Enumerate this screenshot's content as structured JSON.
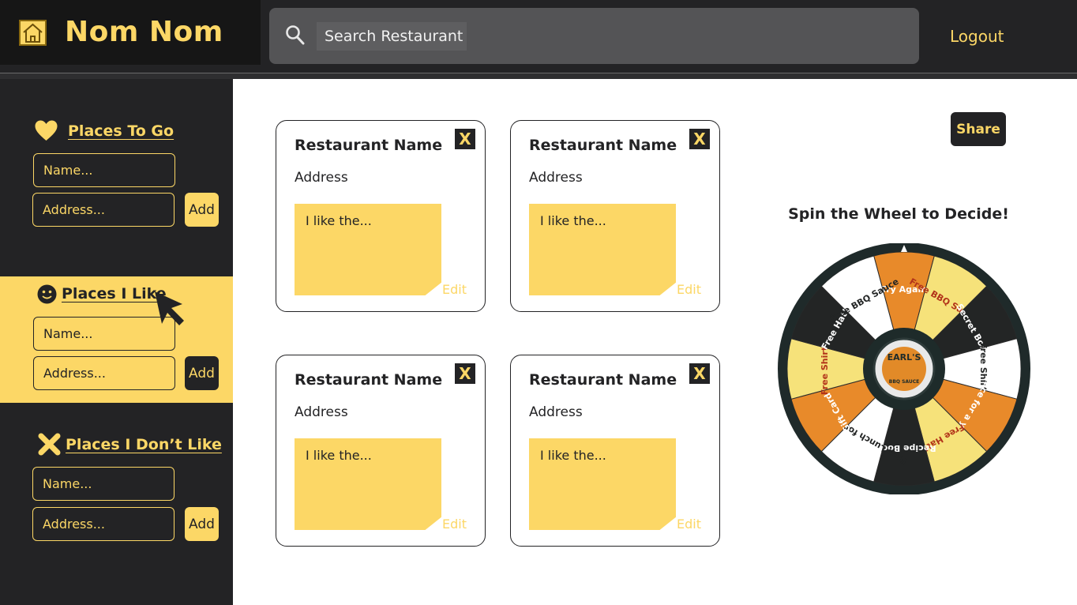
{
  "header": {
    "brand": "Nom Nom",
    "search_placeholder": "Search Restaurant",
    "logout": "Logout"
  },
  "sidebar": {
    "sections": [
      {
        "title": "Places To Go",
        "icon": "heart-icon",
        "name_placeholder": "Name...",
        "address_placeholder": "Address...",
        "add_label": "Add"
      },
      {
        "title": "Places I Like",
        "icon": "smiley-icon",
        "name_placeholder": "Name...",
        "address_placeholder": "Address...",
        "add_label": "Add"
      },
      {
        "title": "Places I Don’t Like",
        "icon": "x-icon",
        "name_placeholder": "Name...",
        "address_placeholder": "Address...",
        "add_label": "Add"
      }
    ]
  },
  "cards": [
    {
      "name": "Restaurant Name",
      "address": "Address",
      "note": "I like the...",
      "edit": "Edit",
      "close": "X"
    },
    {
      "name": "Restaurant Name",
      "address": "Address",
      "note": "I like the...",
      "edit": "Edit",
      "close": "X"
    },
    {
      "name": "Restaurant Name",
      "address": "Address",
      "note": "I like the...",
      "edit": "Edit",
      "close": "X"
    },
    {
      "name": "Restaurant Name",
      "address": "Address",
      "note": "I like the...",
      "edit": "Edit",
      "close": "X"
    }
  ],
  "share": "Share",
  "wheel": {
    "title": "Spin the Wheel to Decide!",
    "center_logo": "EARL'S",
    "center_sub": "BBQ SAUCE",
    "segments": [
      "Try Again",
      "Free BBQ Sauce",
      "Secret Box!",
      "Free Shirt!",
      "Sauce for a year!",
      "Free Hat!",
      "Recipe Book!",
      "Free Lunch for Two!",
      "Gift Card $",
      "Free Shirt!",
      "Free Hat!",
      "Free BBQ Sauce"
    ]
  },
  "colors": {
    "accent": "#fcd766",
    "dark": "#232325",
    "brand_bg": "#161616",
    "search_bg": "#545456"
  }
}
